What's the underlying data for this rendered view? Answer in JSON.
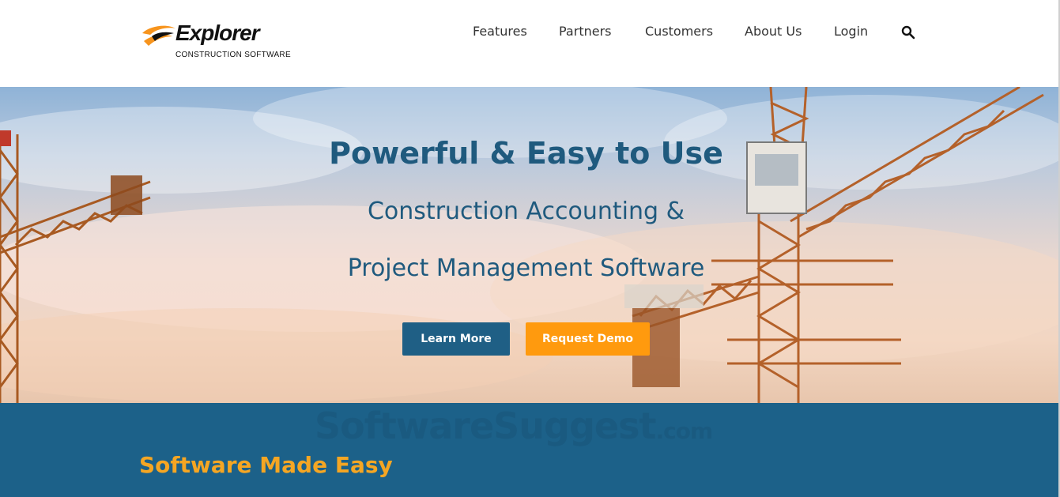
{
  "brand": {
    "name": "Explorer",
    "tagline": "CONSTRUCTION SOFTWARE",
    "accent_orange": "#f7941d",
    "logo_icon": "swoosh-icon"
  },
  "nav": {
    "items": [
      {
        "label": "Features"
      },
      {
        "label": "Partners"
      },
      {
        "label": "Customers"
      },
      {
        "label": "About Us"
      },
      {
        "label": "Login"
      }
    ],
    "search_icon": "search-icon"
  },
  "hero": {
    "title": "Powerful & Easy to Use",
    "subtitle_line1": "Construction Accounting &",
    "subtitle_line2": "Project Management Software",
    "buttons": {
      "learn_more": "Learn More",
      "request_demo": "Request Demo"
    },
    "colors": {
      "text": "#1f5a7e",
      "learn_more_bg": "#1f5f85",
      "request_demo_bg": "#ff9a0e"
    }
  },
  "band": {
    "watermark": "SoftwareSuggest",
    "watermark_suffix": ".com",
    "title": "Software Made Easy",
    "background": "#1c6189",
    "title_color": "#f5a623"
  }
}
